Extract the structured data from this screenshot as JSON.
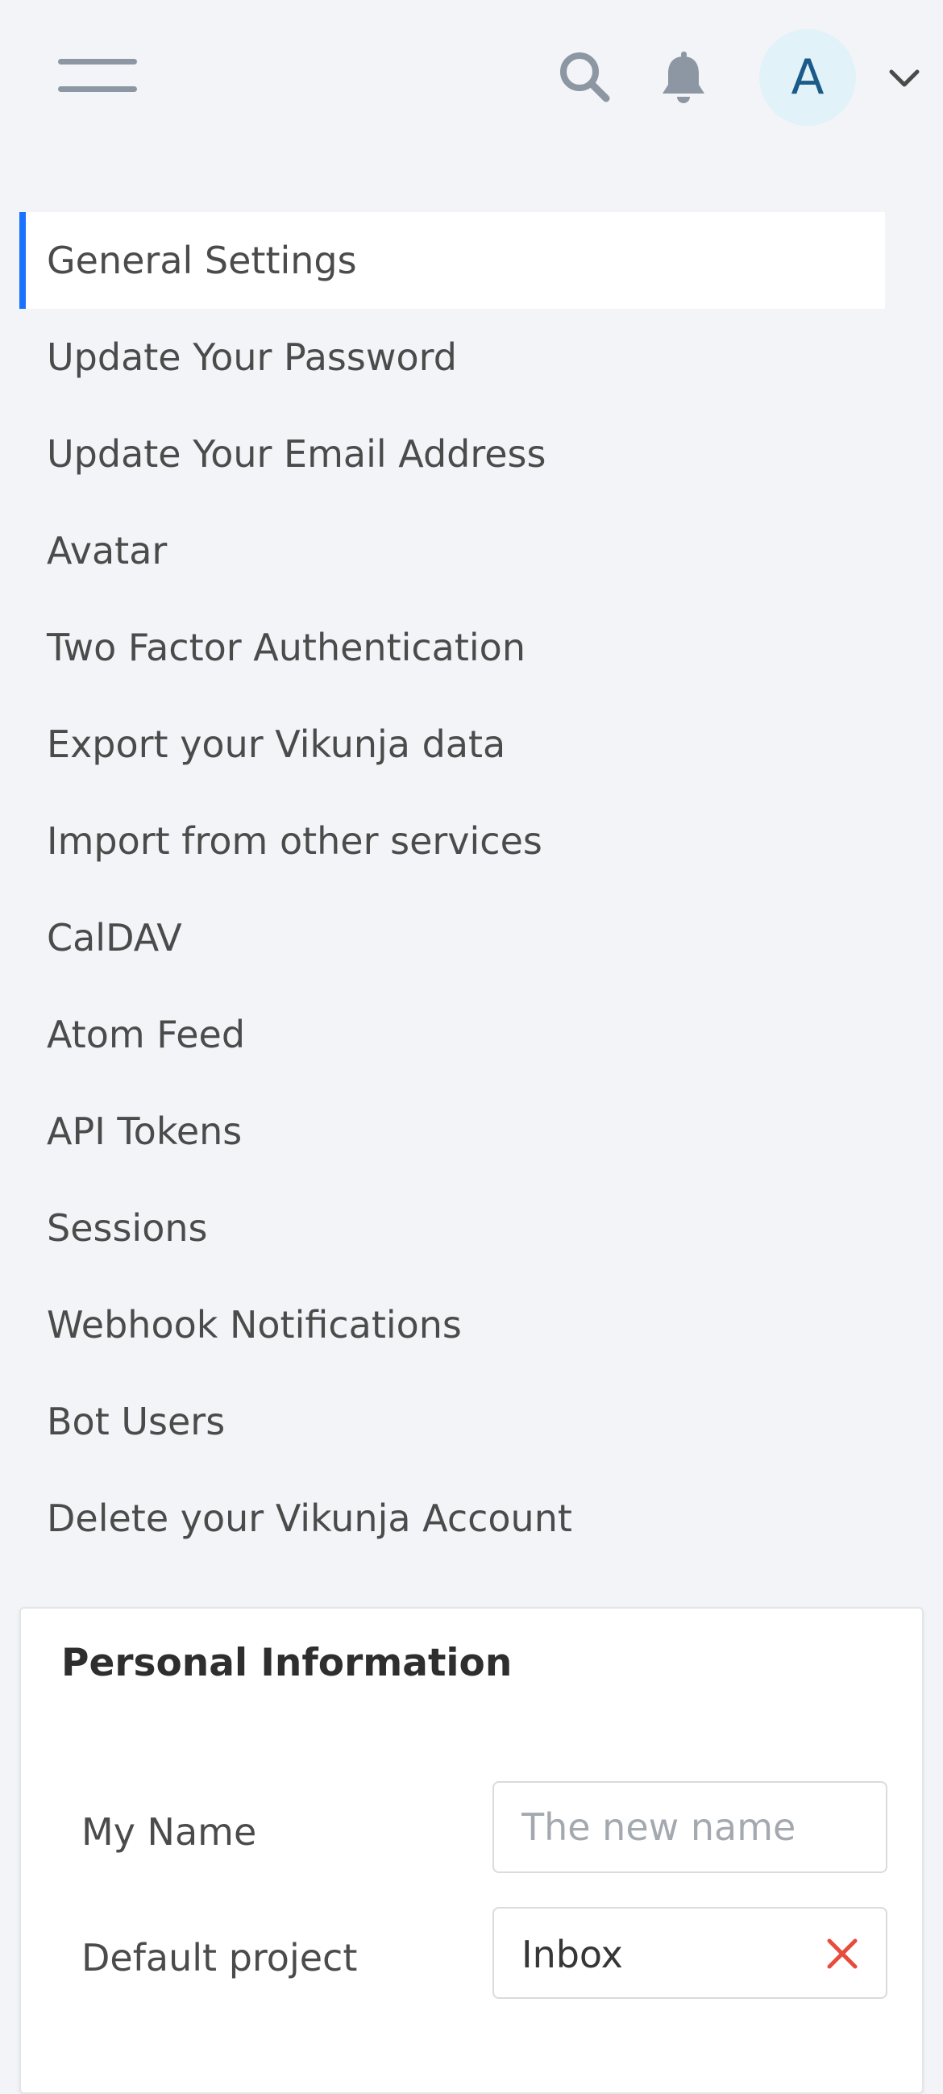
{
  "header": {
    "menu_icon": "hamburger-menu-icon",
    "search_icon": "search-icon",
    "notifications_icon": "bell-icon",
    "avatar_initial": "A",
    "dropdown_icon": "chevron-down-icon"
  },
  "settings_nav": {
    "items": [
      {
        "label": "General Settings",
        "active": true
      },
      {
        "label": "Update Your Password"
      },
      {
        "label": "Update Your Email Address"
      },
      {
        "label": "Avatar"
      },
      {
        "label": "Two Factor Authentication"
      },
      {
        "label": "Export your Vikunja data"
      },
      {
        "label": "Import from other services"
      },
      {
        "label": "CalDAV"
      },
      {
        "label": "Atom Feed"
      },
      {
        "label": "API Tokens"
      },
      {
        "label": "Sessions"
      },
      {
        "label": "Webhook Notifications"
      },
      {
        "label": "Bot Users"
      },
      {
        "label": "Delete your Vikunja Account"
      }
    ]
  },
  "personal_info": {
    "title": "Personal Information",
    "name_label": "My Name",
    "name_value": "",
    "name_placeholder": "The new name",
    "default_project_label": "Default project",
    "default_project_value": "Inbox",
    "clear_icon": "close-x-icon"
  },
  "colors": {
    "page_bg": "#f3f4f7",
    "accent": "#1973ff",
    "icon_gray": "#8d97a3",
    "avatar_bg": "#e2f2f9",
    "avatar_text": "#1b5b8a",
    "danger": "#e74c3c"
  }
}
